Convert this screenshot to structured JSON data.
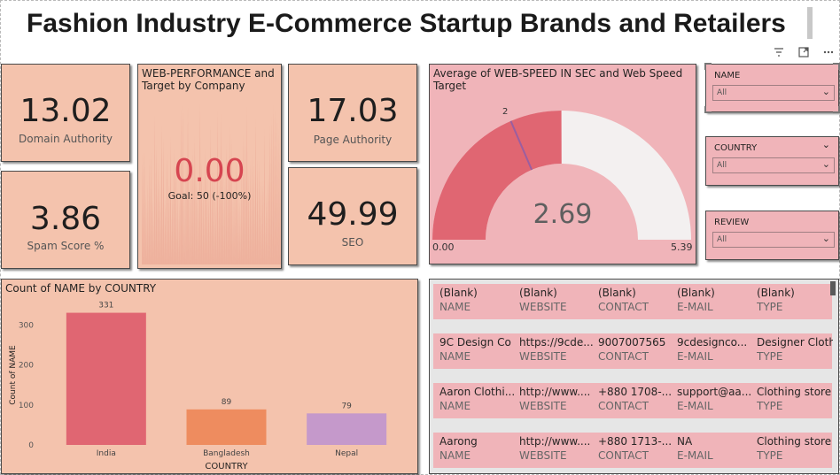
{
  "title": "Fashion Industry E-Commerce Startup Brands and Retailers",
  "visual_header_icons": [
    "filter-icon",
    "focus-mode-icon",
    "more-options-icon"
  ],
  "kpis": {
    "domain_authority": {
      "value": "13.02",
      "label": "Domain Authority"
    },
    "spam_score": {
      "value": "3.86",
      "label": "Spam Score %"
    },
    "page_authority": {
      "value": "17.03",
      "label": "Page Authority"
    },
    "seo": {
      "value": "49.99",
      "label": "SEO"
    }
  },
  "web_performance": {
    "title": "WEB-PERFORMANCE and Target by Company",
    "value": "0.00",
    "flag": "!",
    "goal": "Goal: 50 (-100%)"
  },
  "gauge": {
    "title": "Average of WEB-SPEED IN SEC and Web Speed Target",
    "value": "2.69",
    "min_label": "0.00",
    "max_label": "5.39",
    "target_label": "2",
    "value_num": 2.69,
    "min": 0,
    "max": 5.39,
    "target": 2,
    "fill_color": "#e06672",
    "track_color": "#f3f0f0",
    "target_color": "#9b5ea0"
  },
  "slicers": [
    {
      "label": "NAME",
      "value": "All"
    },
    {
      "label": "COUNTRY",
      "value": "All"
    },
    {
      "label": "REVIEW",
      "value": "All"
    }
  ],
  "chart_data": {
    "type": "bar",
    "title": "Count of NAME by COUNTRY",
    "categories": [
      "India",
      "Bangladesh",
      "Nepal"
    ],
    "values": [
      331,
      89,
      79
    ],
    "colors": [
      "#e06672",
      "#ee8c5f",
      "#c599cb"
    ],
    "xlabel": "COUNTRY",
    "ylabel": "Count of NAME",
    "yticks": [
      "0",
      "100",
      "200",
      "300"
    ],
    "ylim": [
      0,
      350
    ],
    "grid": false
  },
  "table": {
    "columns": [
      "NAME",
      "WEBSITE",
      "CONTACT",
      "E-MAIL",
      "TYPE"
    ],
    "rows": [
      [
        "(Blank)",
        "(Blank)",
        "(Blank)",
        "(Blank)",
        "(Blank)"
      ],
      [
        "9C Design Co",
        "https://9cde...",
        "9007007565",
        "9cdesignco...",
        "Designer Clothi..."
      ],
      [
        "Aaron Clothi...",
        "http://www....",
        "+880 1708-...",
        "support@aa...",
        "Clothing store"
      ],
      [
        "Aarong",
        "http://www....",
        "+880 1713-...",
        "NA",
        "Clothing store"
      ]
    ]
  }
}
